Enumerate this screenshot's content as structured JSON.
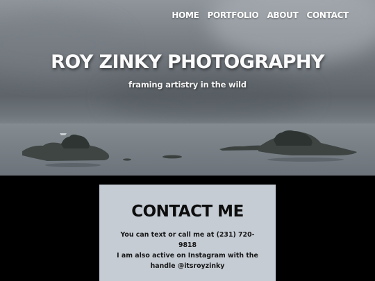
{
  "nav": {
    "items": [
      {
        "label": "HOME"
      },
      {
        "label": "PORTFOLIO"
      },
      {
        "label": "ABOUT"
      },
      {
        "label": "CONTACT"
      }
    ]
  },
  "hero": {
    "title": "ROY ZINKY PHOTOGRAPHY",
    "tagline": "framing artistry in the wild"
  },
  "contact": {
    "heading": "CONTACT ME",
    "phone_text": "You can text or call me at (231) 720-9818",
    "instagram_text": "I am also active on Instagram with the handle @itsroyzinky"
  },
  "colors": {
    "page_background": "#000000",
    "card_background": "#c5ccd4",
    "nav_text": "#ffffff"
  }
}
